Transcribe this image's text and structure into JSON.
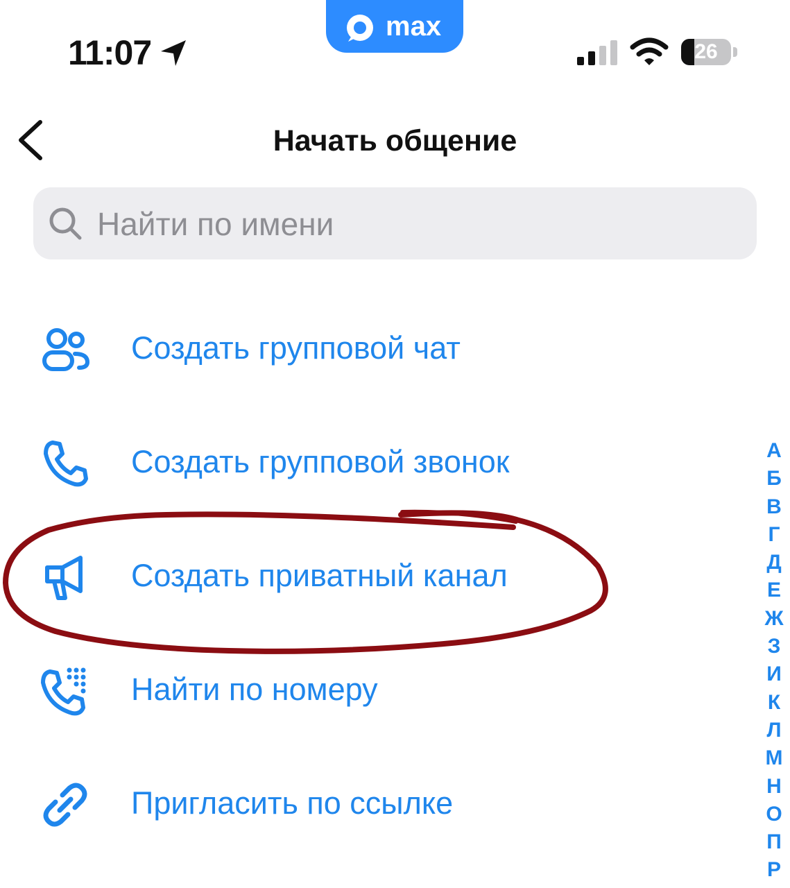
{
  "status_bar": {
    "time": "11:07",
    "battery_level": "26",
    "battery_fraction": 0.26,
    "brand_name": "max",
    "brand_color": "#2d8cff"
  },
  "nav": {
    "back_icon": "chevron-left-icon",
    "title": "Начать общение"
  },
  "search": {
    "icon": "search-icon",
    "placeholder": "Найти по имени",
    "value": ""
  },
  "actions": [
    {
      "icon": "group-icon",
      "label": "Создать групповой чат"
    },
    {
      "icon": "phone-icon",
      "label": "Создать групповой звонок"
    },
    {
      "icon": "megaphone-icon",
      "label": "Создать приватный канал",
      "highlighted": true
    },
    {
      "icon": "dialpad-phone-icon",
      "label": "Найти по номеру"
    },
    {
      "icon": "link-icon",
      "label": "Пригласить по ссылке"
    }
  ],
  "alphabet_index": [
    "А",
    "Б",
    "В",
    "Г",
    "Д",
    "Е",
    "Ж",
    "З",
    "И",
    "К",
    "Л",
    "М",
    "Н",
    "О",
    "П",
    "Р"
  ],
  "colors": {
    "accent": "#1f86ec",
    "highlight_annotation": "#8b0d12",
    "search_background": "#ededf0",
    "placeholder": "#8e8e93"
  }
}
